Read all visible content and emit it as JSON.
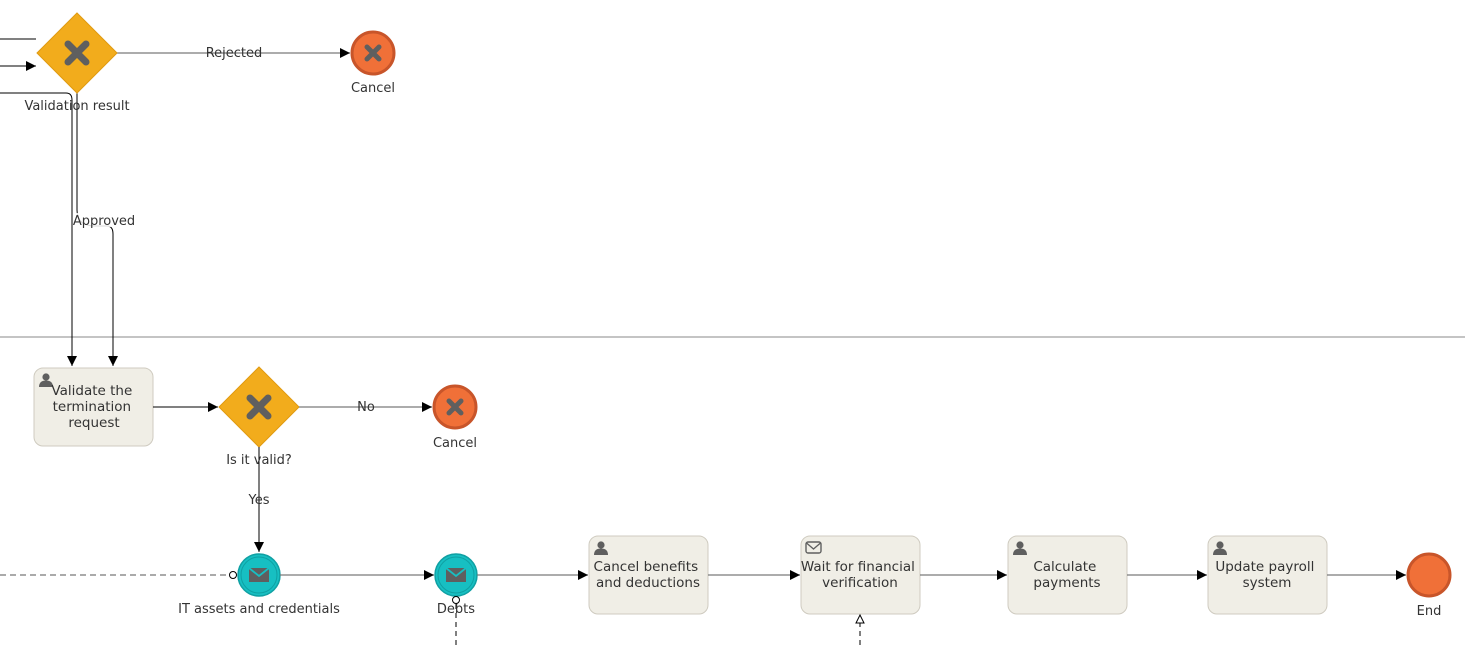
{
  "colors": {
    "gateway": "#f2ac1c",
    "gateway_stroke": "#e09a10",
    "gateway_mark": "#5f5f5f",
    "cancel_fill": "#f07038",
    "cancel_stroke": "#c8552a",
    "message_fill": "#17bfc2",
    "message_stroke": "#10a0a3",
    "task_fill": "#f0eee6",
    "task_stroke": "#cfcbc0",
    "icon": "#5f5f5f",
    "flow": "#000000",
    "flow_gray": "#7a7a7a",
    "lane_line": "#8a8a8a"
  },
  "gateways": {
    "validation_result": "Validation result",
    "is_it_valid": "Is it valid?"
  },
  "events": {
    "cancel_top": "Cancel",
    "cancel_mid": "Cancel",
    "it_assets": "IT assets and credentials",
    "debts": "Debts",
    "end": "End"
  },
  "tasks": {
    "validate": [
      "Validate the",
      "termination",
      "request"
    ],
    "cancel_benefits": [
      "Cancel benefits",
      "and deductions"
    ],
    "wait_financial": [
      "Wait for financial",
      "verification"
    ],
    "calculate": [
      "Calculate",
      "payments"
    ],
    "update_payroll": [
      "Update payroll",
      "system"
    ]
  },
  "flows": {
    "rejected": "Rejected",
    "approved": "Approved",
    "no": "No",
    "yes": "Yes"
  }
}
